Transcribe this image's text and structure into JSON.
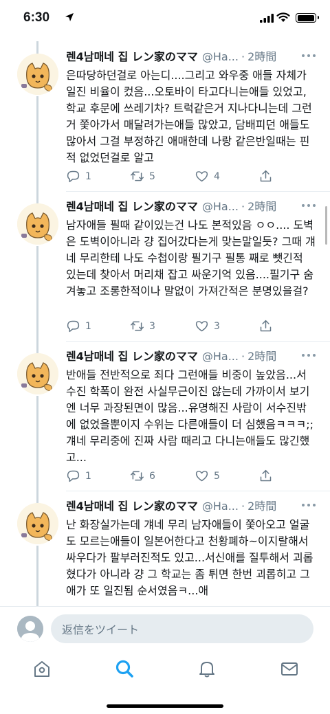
{
  "status": {
    "time": "6:30"
  },
  "author": {
    "name": "렌4남매네 집 レン家のママ",
    "handle": "@Ha..."
  },
  "colors": {
    "accent": "#1da1f2",
    "muted": "#657786",
    "text": "#14171a",
    "divider": "#e6ecf0"
  },
  "tweets": [
    {
      "time": "2時間",
      "text": "은따당하던걸로 아는디....그리고 와우중 애들 자체가 일진 비율이 컸음...오토바이 타고다니는애들 있었고, 학교 후문에 쓰레기차? 트럭같은거 지나다니는데 그런거 쫓아가서 매달려가는애들 많았고, 담배피던 애들도 많아서 그걸 부정하긴 애매한데 나랑 같은반일때는 핀적 없었던걸로 알고",
      "replies": "1",
      "retweets": "5",
      "likes": "4"
    },
    {
      "time": "2時間",
      "text": "남자애들 필때 같이있는건 나도 본적있음 ㅇㅇ.... 도벽은 도벽이아니라 걍 집어갔다는게 맞는말일듯? 그때 걔네 무리한테 나도 수첩이랑 필기구 필통 째로 뺏긴적 있는데 찾아서 머리채 잡고 싸운기억 있음....필기구 숨겨놓고 조롱한적이나 말없이 가져간적은 분명있을걸?",
      "replies": "1",
      "retweets": "3",
      "likes": "3"
    },
    {
      "time": "2時間",
      "text": "반애들 전반적으로 죄다 그런애들 비중이 높았음...서수진 학폭이 완전 사실무근이진 않는데 가까이서 보기엔 너무 과장된면이 많음...유명해진 사람이 서수진밖에 없었을뿐이지 수위는 다른애들이 더 심했음ㅋㅋㅋ;; 걔네 무리중에 진짜 사람 때리고 다니는애들도 많긴했고...",
      "replies": "1",
      "retweets": "6",
      "likes": "5"
    },
    {
      "time": "2時間",
      "text": "난 화장실가는데 걔네 무리 남자애들이 쫓아오고 얼굴도 모르는애들이 일본어한다고 천황폐하~이지랄해서 싸우다가 팔부러진적도 있고...서신애를 질투해서 괴롭혔다가 아니라 걍 그 학교는 좀 튀면 한번 괴롭히고 그애가 또 일진됨 순서였음ㅋ...애",
      "replies": "",
      "retweets": "",
      "likes": ""
    }
  ],
  "reply_placeholder": "返信をツイート",
  "tabs": [
    "home-icon",
    "search-icon",
    "notifications-icon",
    "messages-icon"
  ]
}
